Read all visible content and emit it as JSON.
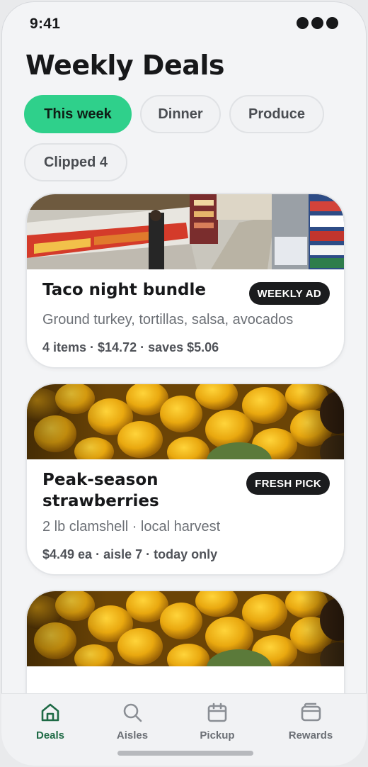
{
  "status_bar": {
    "time": "9:41"
  },
  "header": {
    "title": "Weekly Deals"
  },
  "filters": [
    {
      "label": "This week",
      "active": true
    },
    {
      "label": "Dinner",
      "active": false
    },
    {
      "label": "Produce",
      "active": false
    },
    {
      "label": "Clipped 4",
      "active": false
    }
  ],
  "deals": [
    {
      "title": "Taco night bundle",
      "badge": "WEEKLY AD",
      "description": "Ground turkey, tortillas, salsa, avocados",
      "meta": "4 items · $14.72 · saves $5.06",
      "image": "grocery-aisle-photo"
    },
    {
      "title_line1": "Peak-season",
      "title_line2": "strawberries",
      "badge": "FRESH PICK",
      "description": "2 lb clamshell · local harvest",
      "meta": "$4.49 ea · aisle 7 · today only",
      "image": "lemons-photo"
    },
    {
      "image": "lemons-photo"
    }
  ],
  "tabs": [
    {
      "label": "Deals",
      "icon": "home-icon",
      "active": true
    },
    {
      "label": "Aisles",
      "icon": "search-icon",
      "active": false
    },
    {
      "label": "Pickup",
      "icon": "calendar-icon",
      "active": false
    },
    {
      "label": "Rewards",
      "icon": "wallet-icon",
      "active": false
    }
  ],
  "colors": {
    "accent": "#2fd08b",
    "active_tab": "#1e6a45",
    "badge": "#1b1c1e"
  }
}
